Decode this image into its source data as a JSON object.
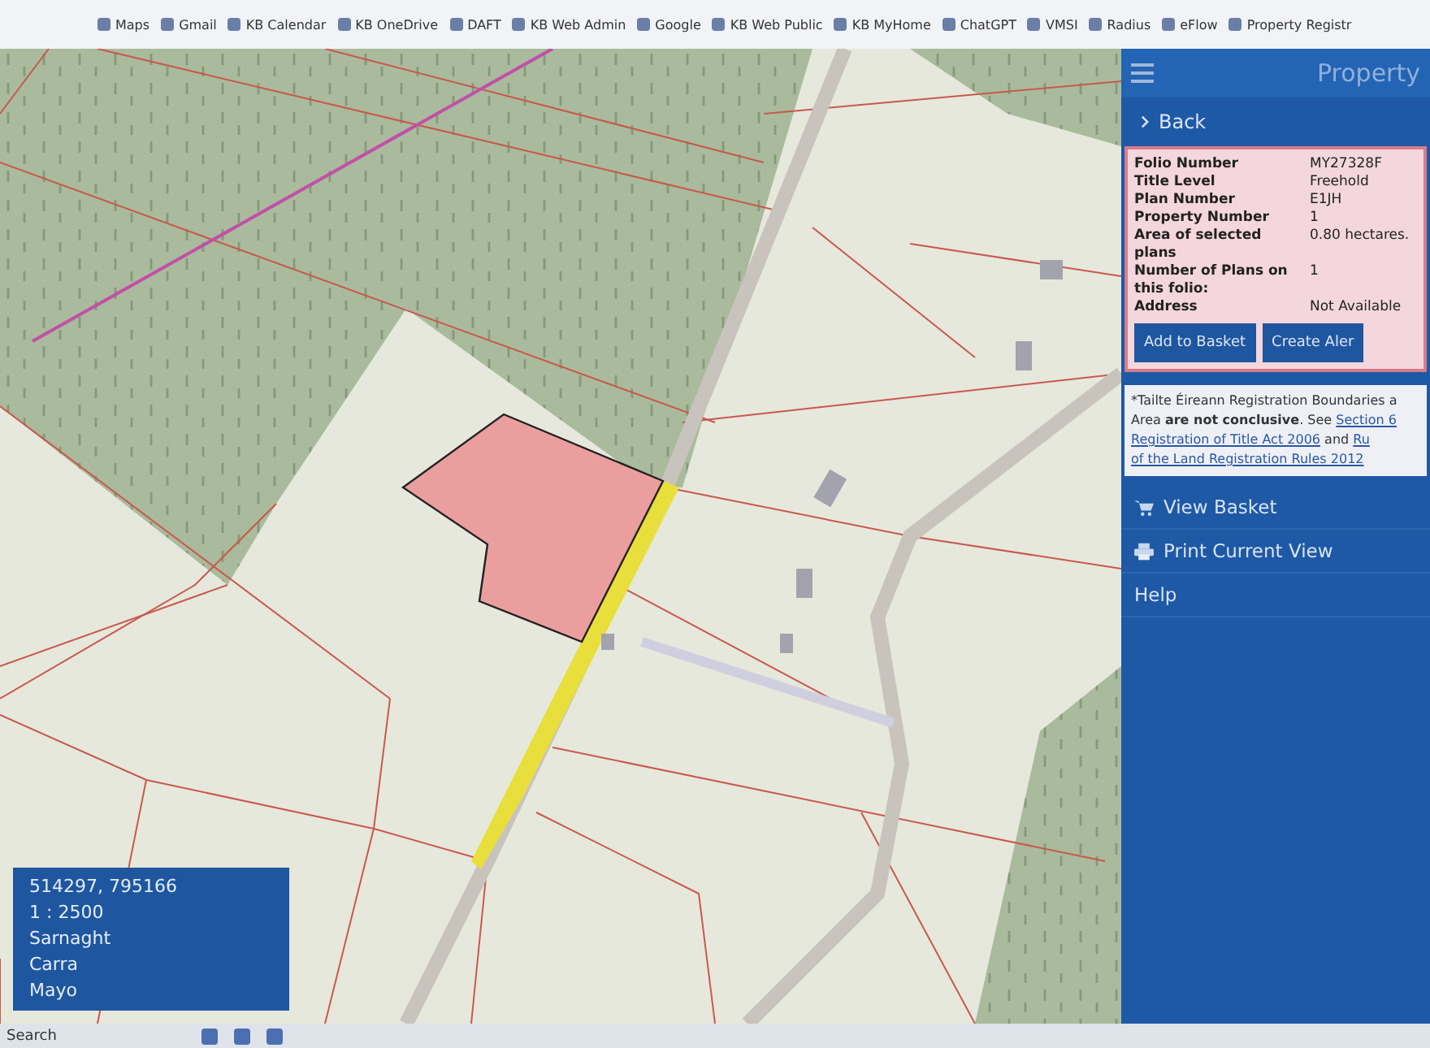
{
  "bookmarks": [
    {
      "label": "Maps"
    },
    {
      "label": "Gmail"
    },
    {
      "label": "KB Calendar"
    },
    {
      "label": "KB OneDrive"
    },
    {
      "label": "DAFT"
    },
    {
      "label": "KB Web Admin"
    },
    {
      "label": "Google"
    },
    {
      "label": "KB Web Public"
    },
    {
      "label": "KB MyHome"
    },
    {
      "label": "ChatGPT"
    },
    {
      "label": "VMSI"
    },
    {
      "label": "Radius"
    },
    {
      "label": "eFlow"
    },
    {
      "label": "Property Registr"
    }
  ],
  "map_info": [
    "514297, 795166",
    "1 : 2500",
    "Sarnaght",
    "Carra",
    "Mayo"
  ],
  "sidebar": {
    "title": "Property",
    "back": "Back",
    "details": [
      {
        "label": "Folio Number",
        "value": "MY27328F"
      },
      {
        "label": "Title Level",
        "value": "Freehold"
      },
      {
        "label": "Plan Number",
        "value": "E1JH"
      },
      {
        "label": "Property Number",
        "value": "1"
      },
      {
        "label": "Area of selected plans",
        "value": "0.80 hectares."
      },
      {
        "label": "Number of Plans on this folio:",
        "value": "1"
      },
      {
        "label": "Address",
        "value": "Not Available"
      }
    ],
    "buttons": [
      "Add to Basket",
      "Create Aler"
    ],
    "notice": [
      [
        {
          "text": "*Tailte Éireann Registration Boundaries a",
          "link": false
        }
      ],
      [
        {
          "text": "Area **are not conclusive**. See ",
          "link": false
        },
        {
          "text": "Section 6",
          "link": true
        }
      ],
      [
        {
          "text": "Registration of Title Act 2006",
          "link": true
        },
        {
          "text": " and ",
          "link": false
        },
        {
          "text": "Ru",
          "link": true
        }
      ],
      [
        {
          "text": "of the Land Registration Rules 2012",
          "link": true
        }
      ]
    ],
    "menu": [
      {
        "label": "View Basket",
        "kind": "basket"
      },
      {
        "label": "Print Current View",
        "kind": "print"
      },
      {
        "label": "Help",
        "kind": "plain"
      }
    ]
  },
  "taskbar": {
    "search": "Search"
  }
}
